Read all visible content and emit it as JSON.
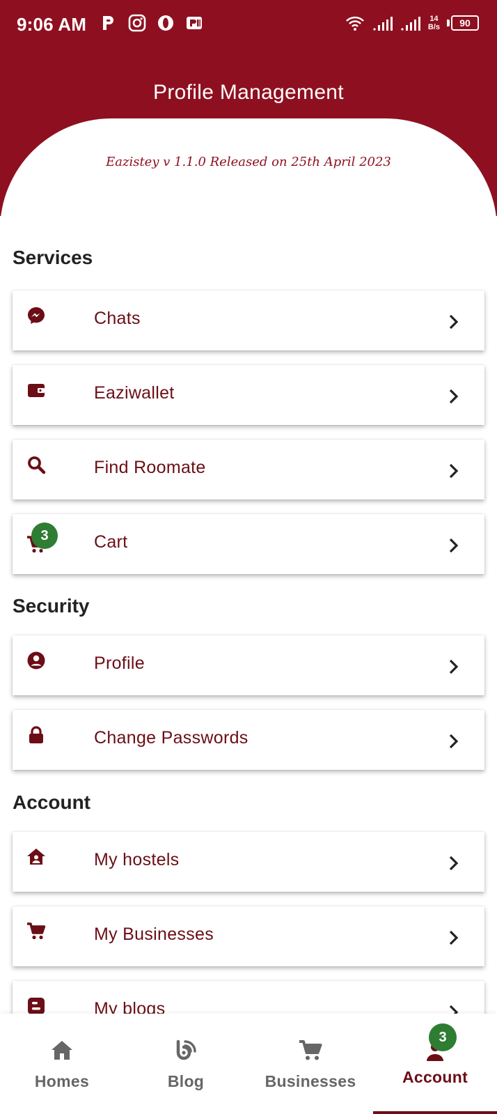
{
  "status_bar": {
    "time": "9:06 AM",
    "net_speed_value": "14",
    "net_speed_unit": "B/s",
    "battery": "90",
    "icons": [
      "p-icon",
      "instagram-icon",
      "opera-icon",
      "p-icon-2",
      "wifi-icon",
      "signal-icon",
      "signal-icon-2"
    ]
  },
  "header": {
    "title": "Profile Management",
    "release_note": "Eazistey v 1.1.0 Released on 25th April 2023"
  },
  "sections": {
    "services": {
      "title": "Services",
      "items": [
        {
          "label": "Chats",
          "icon": "messenger-icon"
        },
        {
          "label": "Eaziwallet",
          "icon": "wallet-icon"
        },
        {
          "label": "Find Roomate",
          "icon": "search-icon"
        },
        {
          "label": "Cart",
          "icon": "cart-icon",
          "badge": "3"
        }
      ]
    },
    "security": {
      "title": "Security",
      "items": [
        {
          "label": "Profile",
          "icon": "user-circle-icon"
        },
        {
          "label": "Change Passwords",
          "icon": "lock-icon"
        }
      ]
    },
    "account": {
      "title": "Account",
      "items": [
        {
          "label": "My hostels",
          "icon": "house-user-icon"
        },
        {
          "label": "My Businesses",
          "icon": "cart-icon"
        },
        {
          "label": "My blogs",
          "icon": "blogger-icon"
        }
      ]
    }
  },
  "bottom_nav": {
    "items": [
      {
        "label": "Homes",
        "icon": "home-icon"
      },
      {
        "label": "Blog",
        "icon": "blog-icon"
      },
      {
        "label": "Businesses",
        "icon": "cart-icon"
      },
      {
        "label": "Account",
        "icon": "user-icon",
        "badge": "3",
        "active": true
      }
    ]
  },
  "colors": {
    "brand": "#8e1020",
    "label": "#6b0e16",
    "badge": "#2e7d32",
    "nav_inactive": "#666666"
  }
}
